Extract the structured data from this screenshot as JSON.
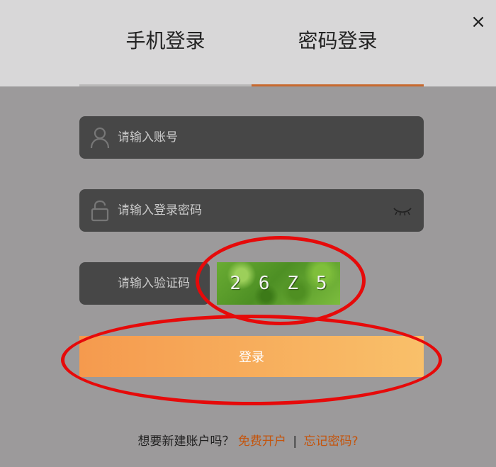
{
  "tabs": {
    "phone_login": "手机登录",
    "password_login": "密码登录",
    "active": "password_login"
  },
  "close": {
    "label": "×"
  },
  "fields": {
    "account_placeholder": "请输入账号",
    "password_placeholder": "请输入登录密码",
    "captcha_placeholder": "请输入验证码"
  },
  "captcha": {
    "chars": [
      "2",
      "6",
      "Z",
      "5"
    ]
  },
  "login_button": "登录",
  "footer": {
    "prompt": "想要新建账户吗？",
    "register_link": "免费开户",
    "separator": "|",
    "forgot_link": "忘记密码?"
  },
  "colors": {
    "accent": "#c8692e",
    "button_start": "#f59a4e",
    "button_end": "#f9c06a",
    "link": "#c4540c",
    "annotation": "#e60a0a"
  },
  "icons": [
    "close-icon",
    "user-icon",
    "lock-icon",
    "eye-closed-icon"
  ]
}
